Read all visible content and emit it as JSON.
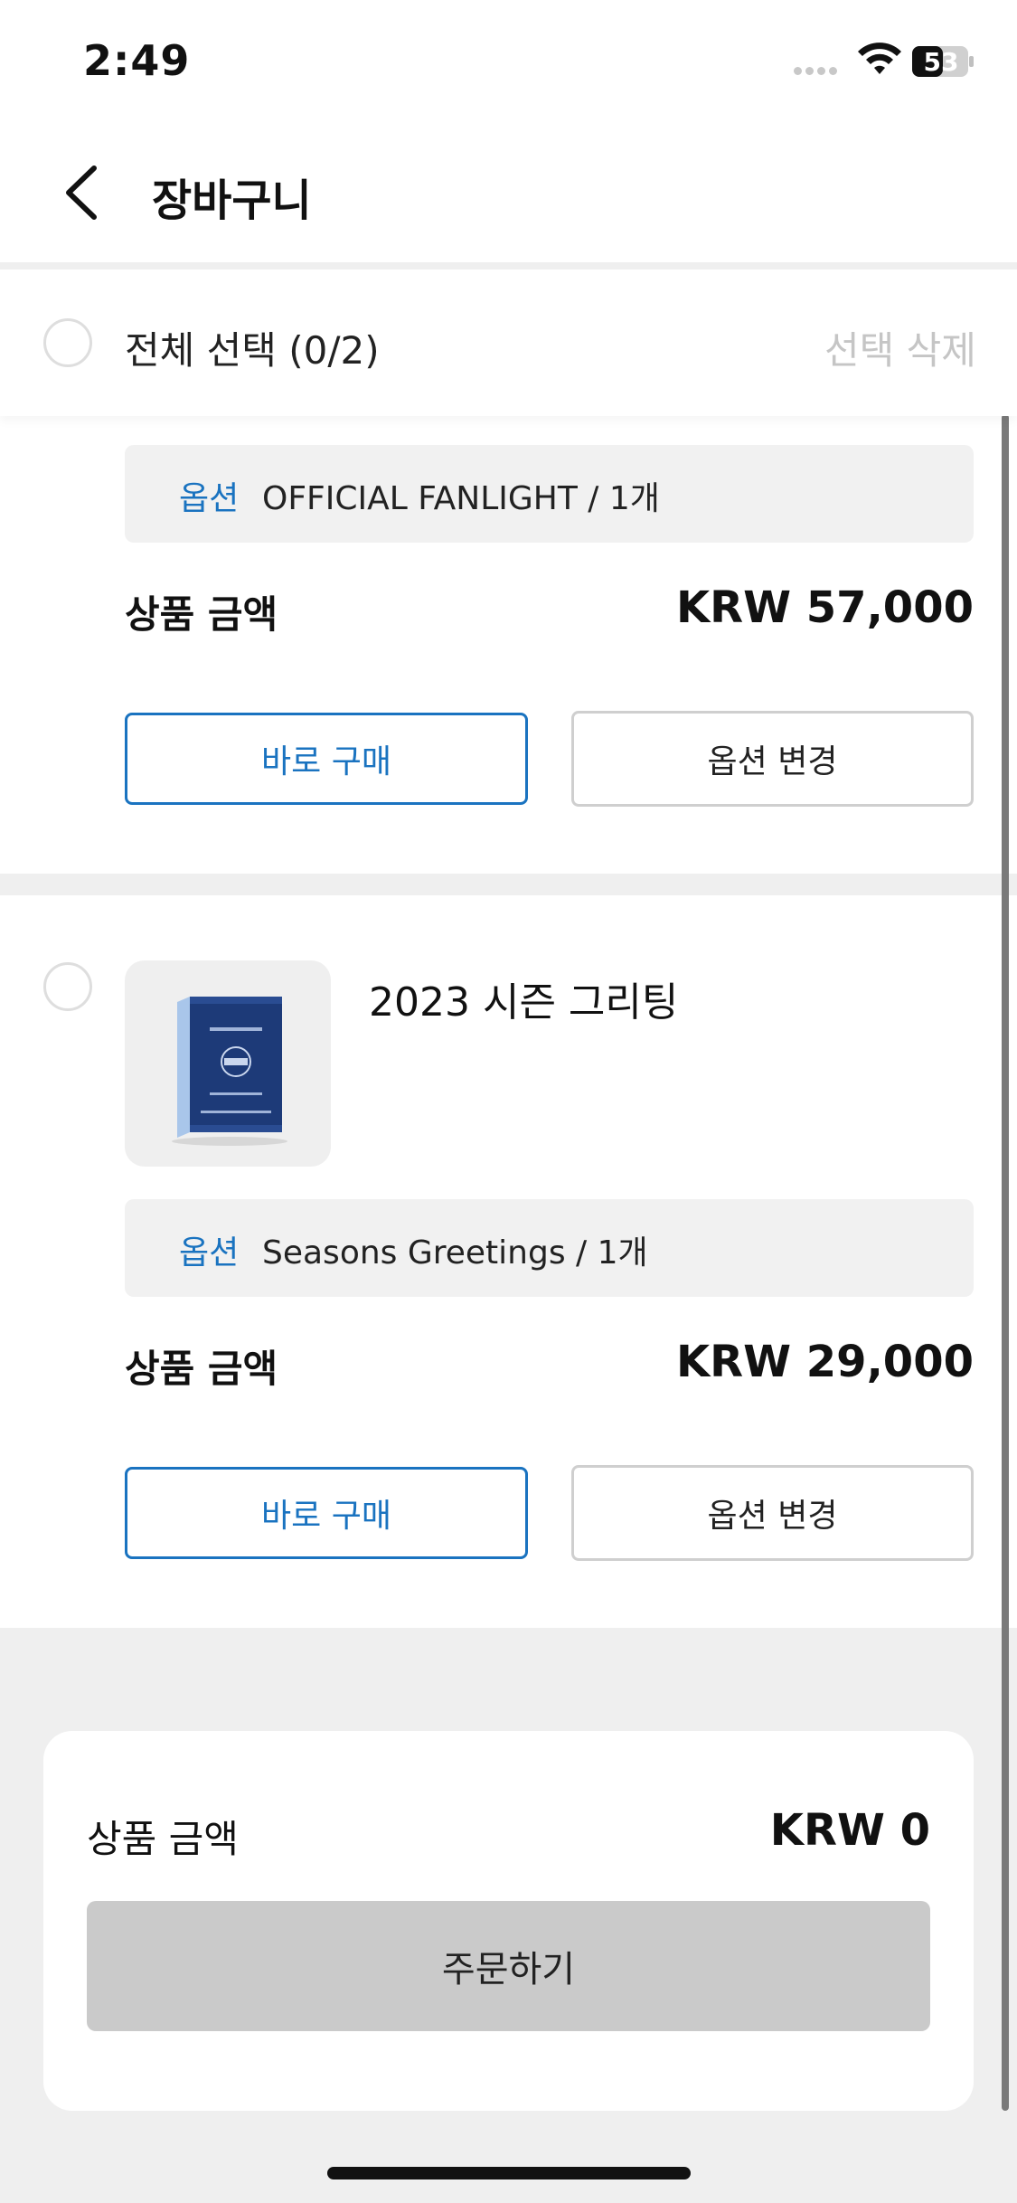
{
  "status_bar": {
    "time": "2:49",
    "battery": "53"
  },
  "header": {
    "title": "장바구니",
    "back_icon": "chevron-left-icon"
  },
  "select_bar": {
    "select_all_label": "전체 선택 (0/2)",
    "delete_selected_label": "선택 삭제"
  },
  "items": [
    {
      "option_key": "옵션",
      "option_value": "OFFICIAL FANLIGHT / 1개",
      "price_label": "상품 금액",
      "price_value": "KRW 57,000",
      "buy_now_label": "바로 구매",
      "change_option_label": "옵션 변경",
      "checked": false
    },
    {
      "title": "2023 시즌 그리팅",
      "thumbnail": "seasons-greetings-box-image",
      "option_key": "옵션",
      "option_value": "Seasons Greetings / 1개",
      "price_label": "상품 금액",
      "price_value": "KRW 29,000",
      "buy_now_label": "바로 구매",
      "change_option_label": "옵션 변경",
      "checked": false
    }
  ],
  "summary": {
    "label": "상품 금액",
    "value": "KRW 0",
    "order_button_label": "주문하기"
  },
  "colors": {
    "accent": "#1a73c0",
    "disabled_button": "#cacaca",
    "divider": "#efefef"
  }
}
